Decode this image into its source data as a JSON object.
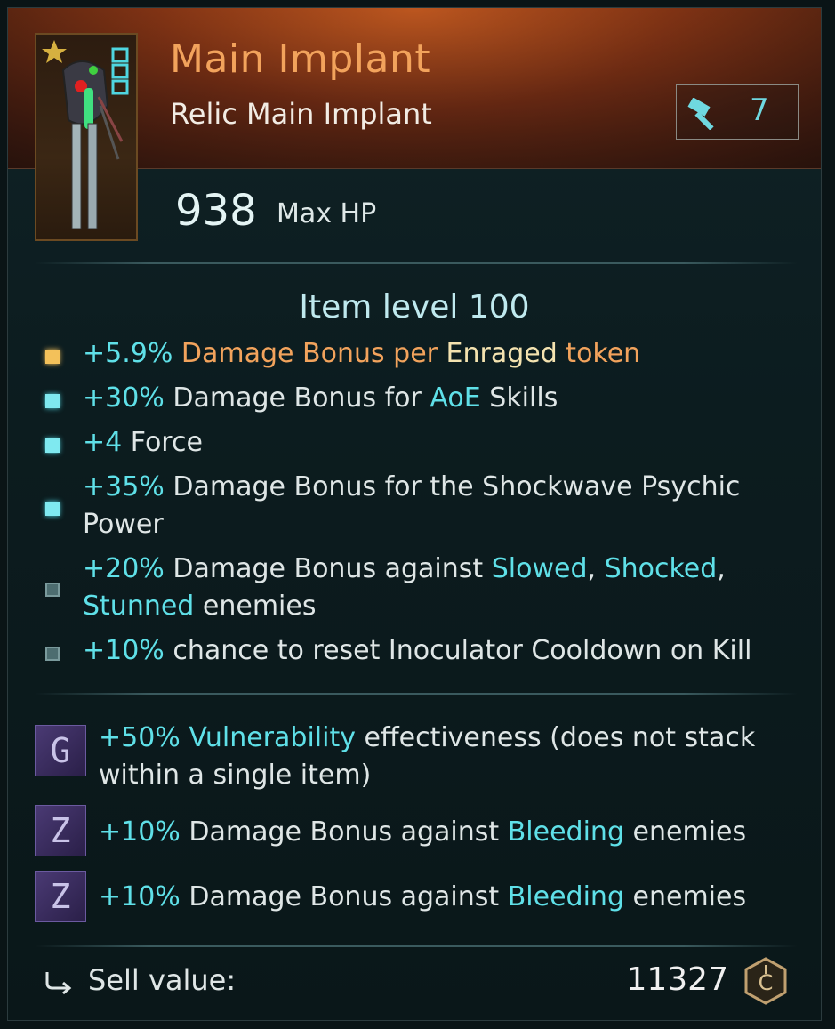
{
  "item": {
    "name": "Main Implant",
    "type": "Relic Main Implant",
    "rarity_color": "#f2a35c",
    "icon": "implant-relic-icon",
    "craft_count": "7",
    "primary_stat": {
      "value": "938",
      "label": "Max HP"
    }
  },
  "item_level_text": "Item level 100",
  "stats": [
    {
      "bullet": "gold",
      "parts": [
        {
          "t": "+5.9%",
          "c": "cyan"
        },
        {
          "t": " Damage Bonus per ",
          "c": "orange"
        },
        {
          "t": "Enraged",
          "c": "cream"
        },
        {
          "t": " token",
          "c": "orange"
        }
      ]
    },
    {
      "bullet": "cyan",
      "parts": [
        {
          "t": "+30%",
          "c": "cyan"
        },
        {
          "t": " Damage Bonus for ",
          "c": "white"
        },
        {
          "t": "AoE",
          "c": "cyan"
        },
        {
          "t": " Skills",
          "c": "white"
        }
      ]
    },
    {
      "bullet": "cyan",
      "parts": [
        {
          "t": "+4",
          "c": "cyan"
        },
        {
          "t": " Force",
          "c": "white"
        }
      ]
    },
    {
      "bullet": "cyan",
      "parts": [
        {
          "t": "+35%",
          "c": "cyan"
        },
        {
          "t": " Damage Bonus for the Shockwave Psychic Power",
          "c": "white"
        }
      ]
    },
    {
      "bullet": "dim",
      "parts": [
        {
          "t": "+20%",
          "c": "cyan"
        },
        {
          "t": " Damage Bonus against ",
          "c": "white"
        },
        {
          "t": "Slowed",
          "c": "cyan"
        },
        {
          "t": ", ",
          "c": "white"
        },
        {
          "t": "Shocked",
          "c": "cyan"
        },
        {
          "t": ", ",
          "c": "white"
        },
        {
          "t": "Stunned",
          "c": "cyan"
        },
        {
          "t": " enemies",
          "c": "white"
        }
      ]
    },
    {
      "bullet": "dim",
      "parts": [
        {
          "t": "+10%",
          "c": "cyan"
        },
        {
          "t": " chance to reset Inoculator Cooldown on Kill",
          "c": "white"
        }
      ]
    }
  ],
  "mods": [
    {
      "glyph": "G",
      "parts": [
        {
          "t": "+50%",
          "c": "cyan"
        },
        {
          "t": " ",
          "c": "white"
        },
        {
          "t": "Vulnerability",
          "c": "cyan"
        },
        {
          "t": " effectiveness (does not stack within a single item)",
          "c": "white"
        }
      ]
    },
    {
      "glyph": "Z",
      "parts": [
        {
          "t": "+10%",
          "c": "cyan"
        },
        {
          "t": " Damage Bonus against ",
          "c": "white"
        },
        {
          "t": "Bleeding",
          "c": "cyan"
        },
        {
          "t": " enemies",
          "c": "white"
        }
      ]
    },
    {
      "glyph": "Z",
      "parts": [
        {
          "t": "+10%",
          "c": "cyan"
        },
        {
          "t": " Damage Bonus against ",
          "c": "white"
        },
        {
          "t": "Bleeding",
          "c": "cyan"
        },
        {
          "t": " enemies",
          "c": "white"
        }
      ]
    }
  ],
  "sell": {
    "label": "Sell value:",
    "amount": "11327",
    "icon": "credits-icon"
  },
  "colors": {
    "accent": "#5fe0e8",
    "title": "#f2a35c",
    "highlight": "#f4e3b0"
  }
}
